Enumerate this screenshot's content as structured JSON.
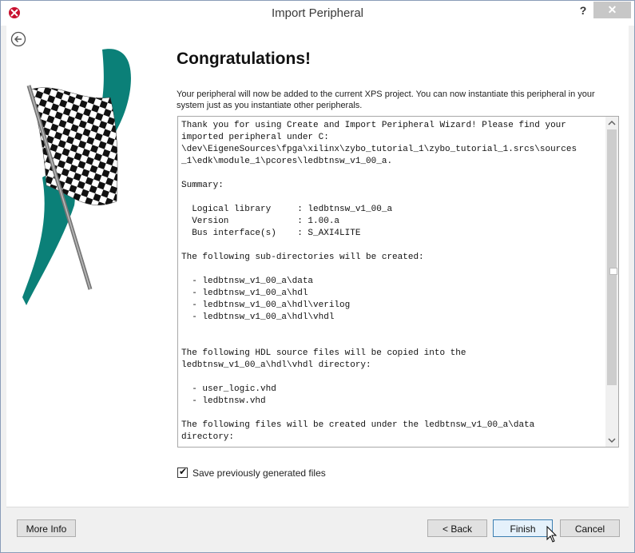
{
  "window": {
    "title": "Import Peripheral",
    "help_label": "?",
    "close_label": "✕"
  },
  "main": {
    "heading": "Congratulations!",
    "description": "Your peripheral will now be added to the current XPS project. You can now instantiate this peripheral in your system just as you instantiate other peripherals.",
    "summary_text": "Thank you for using Create and Import Peripheral Wizard! Please find your\nimported peripheral under C:\n\\dev\\EigeneSources\\fpga\\xilinx\\zybo_tutorial_1\\zybo_tutorial_1.srcs\\sources\n_1\\edk\\module_1\\pcores\\ledbtnsw_v1_00_a.\n\nSummary:\n\n  Logical library     : ledbtnsw_v1_00_a\n  Version             : 1.00.a\n  Bus interface(s)    : S_AXI4LITE\n\nThe following sub-directories will be created:\n\n  - ledbtnsw_v1_00_a\\data\n  - ledbtnsw_v1_00_a\\hdl\n  - ledbtnsw_v1_00_a\\hdl\\verilog\n  - ledbtnsw_v1_00_a\\hdl\\vhdl\n\n\nThe following HDL source files will be copied into the\nledbtnsw_v1_00_a\\hdl\\vhdl directory:\n\n  - user_logic.vhd\n  - ledbtnsw.vhd\n\nThe following files will be created under the ledbtnsw_v1_00_a\\data\ndirectory:",
    "save_checkbox": {
      "label": "Save previously generated files",
      "checked": true
    }
  },
  "footer": {
    "more_info_label": "More Info",
    "back_label": "< Back",
    "finish_label": "Finish",
    "cancel_label": "Cancel"
  },
  "colors": {
    "flag_teal": "#0b8078",
    "accent_blue": "#3c7fb1",
    "close_button": "#c7c7c7"
  },
  "icons": {
    "app": "xilinx-logo-icon",
    "back": "back-arrow-icon",
    "scroll_up": "chevron-up-icon",
    "scroll_down": "chevron-down-icon",
    "cursor": "mouse-pointer-icon"
  }
}
